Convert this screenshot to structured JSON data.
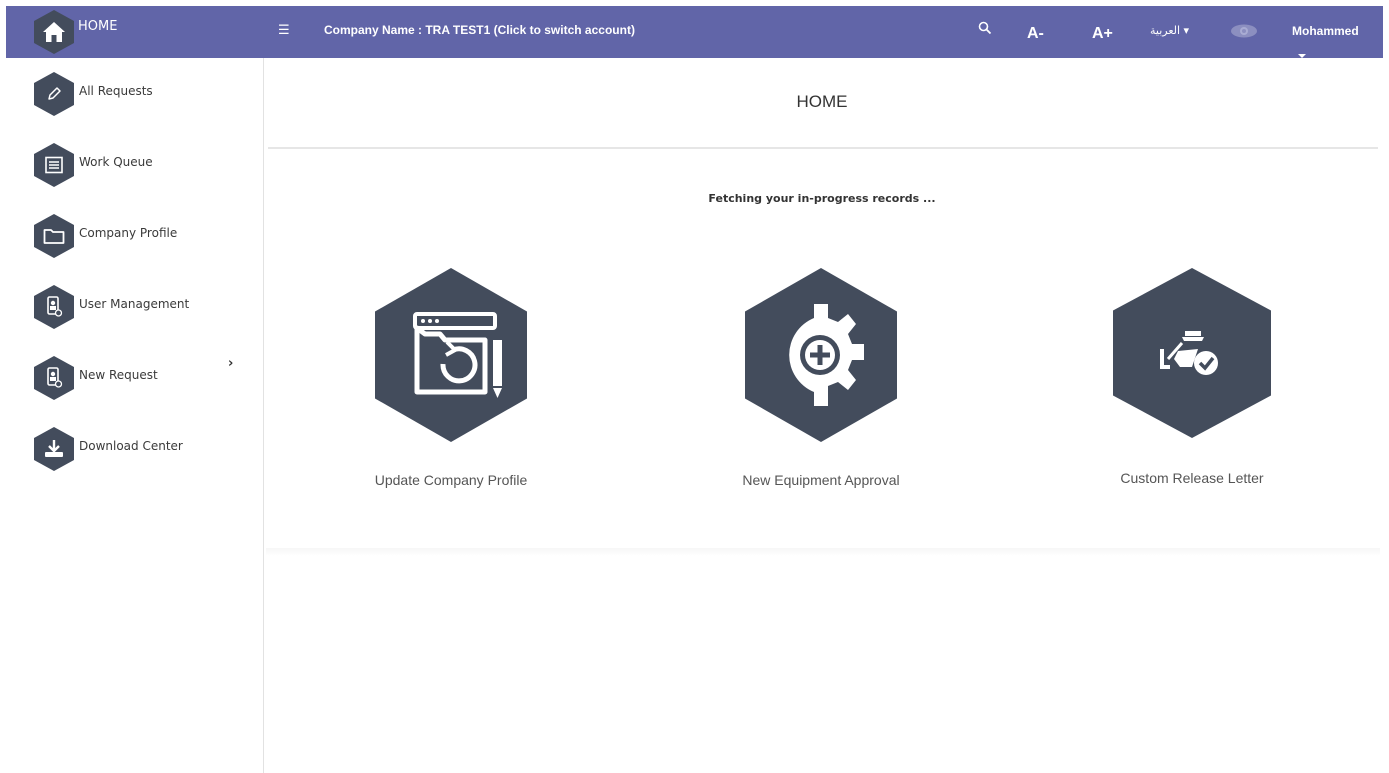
{
  "header": {
    "home_label": "HOME",
    "menu_icon": "☰",
    "company": "Company Name : TRA TEST1 (Click to switch account)",
    "font_decrease": "A-",
    "font_increase": "A+",
    "language": "العربية ▾",
    "user": "Mohammed"
  },
  "sidebar": {
    "items": [
      {
        "label": "All Requests",
        "icon": "pencil-icon"
      },
      {
        "label": "Work Queue",
        "icon": "list-icon"
      },
      {
        "label": "Company Profile",
        "icon": "folder-icon"
      },
      {
        "label": "User Management",
        "icon": "user-badge-icon"
      },
      {
        "label": "New Request",
        "icon": "user-badge-icon"
      },
      {
        "label": "Download Center",
        "icon": "download-icon"
      }
    ],
    "chevron": "›"
  },
  "main": {
    "title": "HOME",
    "status": "Fetching your in-progress records ...",
    "tiles": [
      {
        "label": "Update Company Profile",
        "icon": "folder-refresh-icon"
      },
      {
        "label": "New Equipment Approval",
        "icon": "gear-plus-icon"
      },
      {
        "label": "Custom Release Letter",
        "icon": "officer-check-icon"
      }
    ]
  },
  "colors": {
    "header_bg": "#6165a8",
    "hex_icon": "#434c5c"
  }
}
